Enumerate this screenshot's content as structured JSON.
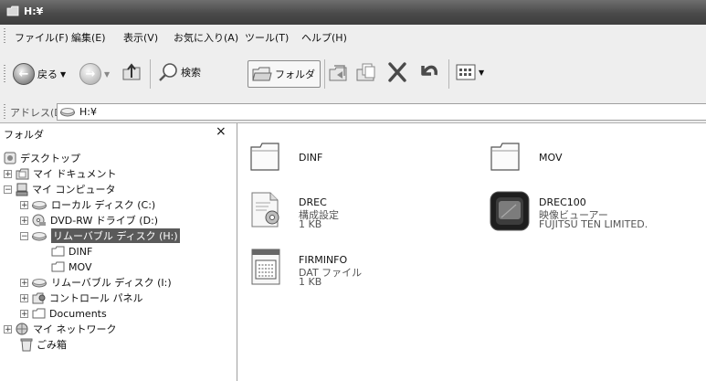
{
  "window": {
    "title": "H:¥"
  },
  "menu": [
    "ファイル(F)",
    "編集(E)",
    "表示(V)",
    "お気に入り(A)",
    "ツール(T)",
    "ヘルプ(H)"
  ],
  "toolbar": {
    "back_label": "戻る",
    "search_label": "検索",
    "folders_label": "フォルダ"
  },
  "address": {
    "label": "アドレス(D)",
    "value": "H:¥"
  },
  "folder_pane": {
    "title": "フォルダ",
    "close": "×",
    "tree": [
      {
        "label": "デスクトップ"
      },
      {
        "label": "マイ ドキュメント"
      },
      {
        "label": "マイ コンピュータ"
      },
      {
        "label": "ローカル ディスク (C:)"
      },
      {
        "label": "DVD-RW ドライブ (D:)"
      },
      {
        "label": "リムーバブル ディスク (H:)"
      },
      {
        "label": "DINF"
      },
      {
        "label": "MOV"
      },
      {
        "label": "リムーバブル ディスク (I:)"
      },
      {
        "label": "コントロール パネル"
      },
      {
        "label": "Documents"
      },
      {
        "label": "マイ ネットワーク"
      },
      {
        "label": "ごみ箱"
      }
    ]
  },
  "files": [
    {
      "name": "DINF",
      "line2": "",
      "line3": "",
      "icon": "folder-icon"
    },
    {
      "name": "MOV",
      "line2": "",
      "line3": "",
      "icon": "folder-icon"
    },
    {
      "name": "DREC",
      "line2": "構成設定",
      "line3": "1 KB",
      "icon": "config-file-icon"
    },
    {
      "name": "DREC100",
      "line2": "映像ビューアー",
      "line3": "FUJITSU TEN LIMITED.",
      "icon": "video-viewer-icon"
    },
    {
      "name": "FIRMINFO",
      "line2": "DAT ファイル",
      "line3": "1 KB",
      "icon": "dat-file-icon"
    }
  ]
}
